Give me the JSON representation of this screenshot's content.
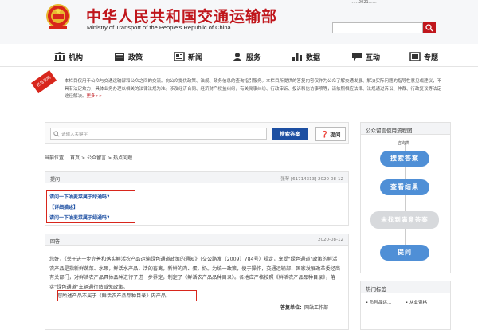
{
  "header": {
    "title_cn": "中华人民共和国交通运输部",
    "title_en": "Ministry of Transport of the People's Republic of China",
    "top_links": "……2021……",
    "brand_color": "#c0161c"
  },
  "nav": {
    "items": [
      {
        "label": "机构",
        "icon": "building-icon"
      },
      {
        "label": "政策",
        "icon": "book-icon"
      },
      {
        "label": "新闻",
        "icon": "newspaper-icon"
      },
      {
        "label": "服务",
        "icon": "service-icon"
      },
      {
        "label": "数据",
        "icon": "chart-icon"
      },
      {
        "label": "互动",
        "icon": "chat-icon"
      },
      {
        "label": "专题",
        "icon": "topic-icon"
      }
    ]
  },
  "intro": {
    "tag": "栏目说明",
    "text": "本栏目仅用于公众与交通运输部和公众之间的交流。向公众提供政策、法规、政务信息的查询指引服务。本栏目所提供的答复内容仅作为公众了解交通发展、解决实际问题的指导性意见或建议，不具有法定效力，具体业务办理以相关的法律法规为准。涉及经济合同、经济财产权益纠纷，有关民事纠纷、行政审诉、投诉和信访事项等，请依照相应法律、法规通过诉讼、仲裁、行政复议等法定途径解决。",
    "more": "更多>>"
  },
  "question_search": {
    "placeholder": "请输入关键字",
    "search_label": "搜索答案",
    "ask_label": "提问"
  },
  "breadcrumb": {
    "prefix": "当前位置：",
    "items": [
      "首页",
      "公众留言",
      "热点问题"
    ],
    "sep": ">"
  },
  "question": {
    "label": "提问",
    "meta": "张琴  [61714313]  2020-08-12",
    "title": "请问一下油麦菜属于绿通吗?",
    "detail_label": "【详细描述】",
    "detail": "请问一下油麦菜属于绿通吗?"
  },
  "answer": {
    "label": "回答",
    "date": "2020-08-12",
    "body": "您好，《关于进一步完善和落实鲜活农产品运输绿色通道政策的通知》（交公路发〔2009〕784号）规定，享受\"绿色通道\"政策的鲜活农产品是指新鲜蔬菜、水果，鲜活水产品，活的畜禽，新鲜的肉、蛋、奶。为统一政策，便于操作，交通运输部、国家发展改革委经商有关部门，对鲜活农产品具体品种进行了进一步界定，制定了《鲜活农产品品种目录》。各地应严格按照《鲜活农产品品种目录》，落实\"绿色通道\"车辆通行费减免政策。",
    "highlight": "您所述产品不属于《鲜活农产品品种目录》内产品。",
    "unit_label": "答复单位：",
    "unit": "网站工作部"
  },
  "flow": {
    "title": "公众留言使用流程图",
    "start": "咨询类",
    "step1": "搜索答案",
    "step2": "查看结果",
    "step3": "未找到满意答案",
    "step4": "提问"
  },
  "hot_tags": {
    "title": "热门标签",
    "items": [
      "危险品运...",
      "从业资格"
    ]
  }
}
